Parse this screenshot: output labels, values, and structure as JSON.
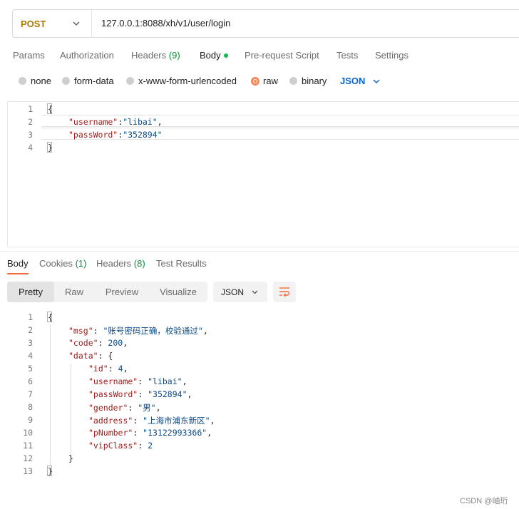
{
  "request": {
    "method": "POST",
    "url": "127.0.0.1:8088/xh/v1/user/login"
  },
  "request_tabs": [
    {
      "label": "Params"
    },
    {
      "label": "Authorization"
    },
    {
      "label": "Headers",
      "count": "(9)"
    },
    {
      "label": "Body"
    },
    {
      "label": "Pre-request Script"
    },
    {
      "label": "Tests"
    },
    {
      "label": "Settings"
    }
  ],
  "body_types": [
    "none",
    "form-data",
    "x-www-form-urlencoded",
    "raw",
    "binary"
  ],
  "body_format": "JSON",
  "request_body": {
    "line_numbers": [
      "1",
      "2",
      "3",
      "4"
    ],
    "open": "{",
    "l2_key": "\"username\"",
    "l2_sep": ":",
    "l2_val": "\"libai\"",
    "l2_end": ",",
    "l3_key": "\"passWord\"",
    "l3_sep": ":",
    "l3_val": "\"352894\"",
    "close": "}"
  },
  "response_tabs": [
    {
      "label": "Body"
    },
    {
      "label": "Cookies",
      "count": "(1)"
    },
    {
      "label": "Headers",
      "count": "(8)"
    },
    {
      "label": "Test Results"
    }
  ],
  "view_modes": [
    "Pretty",
    "Raw",
    "Preview",
    "Visualize"
  ],
  "response_format": "JSON",
  "response_body": {
    "line_numbers": [
      "1",
      "2",
      "3",
      "4",
      "5",
      "6",
      "7",
      "8",
      "9",
      "10",
      "11",
      "12",
      "13"
    ],
    "open": "{",
    "msg_key": "\"msg\"",
    "msg_val": "\"账号密码正确，校验通过\"",
    "code_key": "\"code\"",
    "code_val": "200",
    "data_key": "\"data\"",
    "data_open": "{",
    "id_key": "\"id\"",
    "id_val": "4",
    "username_key": "\"username\"",
    "username_val": "\"libai\"",
    "password_key": "\"passWord\"",
    "password_val": "\"352894\"",
    "gender_key": "\"gender\"",
    "gender_val": "\"男\"",
    "address_key": "\"address\"",
    "address_val": "\"上海市浦东新区\"",
    "pnumber_key": "\"pNumber\"",
    "pnumber_val": "\"13122993366\"",
    "vip_key": "\"vipClass\"",
    "vip_val": "2",
    "data_close": "}",
    "close": "}",
    "colon": ": ",
    "comma": ","
  },
  "watermark": "CSDN @岫珩",
  "colors": {
    "method": "#ad7a03",
    "accent": "#f26b3a",
    "link_blue": "#0a64c8",
    "json_key": "#a12020",
    "json_value": "#0a4a8a",
    "count_green": "#0f8a3b"
  },
  "icons": {
    "method_dropdown": "chevron-down-icon",
    "format_dropdown": "chevron-down-icon",
    "response_format_dropdown": "chevron-down-icon",
    "wrap": "wrap-lines-icon"
  }
}
